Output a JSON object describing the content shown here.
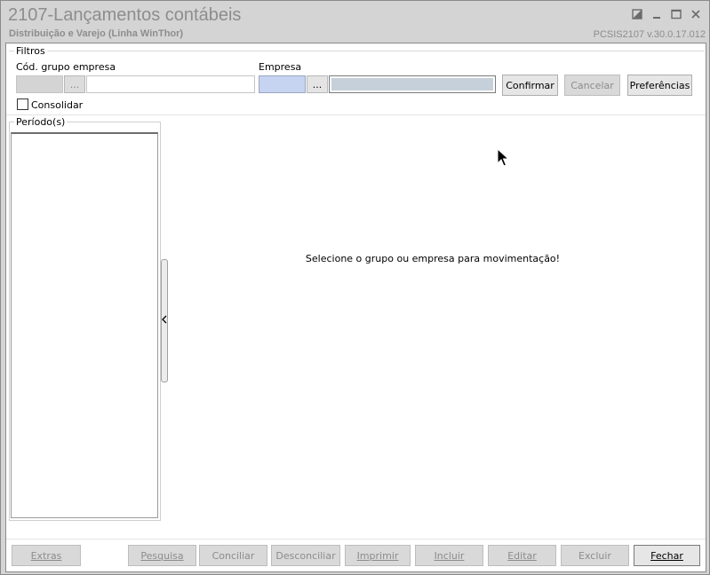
{
  "window": {
    "title": "2107-Lançamentos contábeis",
    "subtitle": "Distribuição e Varejo (Linha WinThor)",
    "version": "PCSIS2107  v.30.0.17.012"
  },
  "filters": {
    "legend": "Filtros",
    "cod_grupo_label": "Cód. grupo empresa",
    "cod_grupo_value": "",
    "cod_grupo_desc": "",
    "empresa_label": "Empresa",
    "empresa_value": "",
    "empresa_desc": "",
    "ellipsis": "...",
    "consolidar_label": "Consolidar",
    "consolidar_checked": false,
    "confirmar_label": "Confirmar",
    "cancelar_label": "Cancelar",
    "preferencias_label": "Preferências"
  },
  "periodo": {
    "legend": "Período(s)",
    "items": []
  },
  "main": {
    "message": "Selecione o grupo ou empresa para movimentação!"
  },
  "footer": {
    "extras": "Extras",
    "pesquisa": "Pesquisa",
    "conciliar": "Conciliar",
    "desconciliar": "Desconciliar",
    "imprimir": "Imprimir",
    "incluir": "Incluir",
    "editar": "Editar",
    "excluir": "Excluir",
    "fechar": "Fechar"
  },
  "icons": {
    "restore": "restore-icon",
    "minimize": "minimize-icon",
    "maximize": "maximize-icon",
    "close": "close-icon",
    "splitter": "chevron-left-icon",
    "cursor": "mouse-pointer-icon"
  }
}
